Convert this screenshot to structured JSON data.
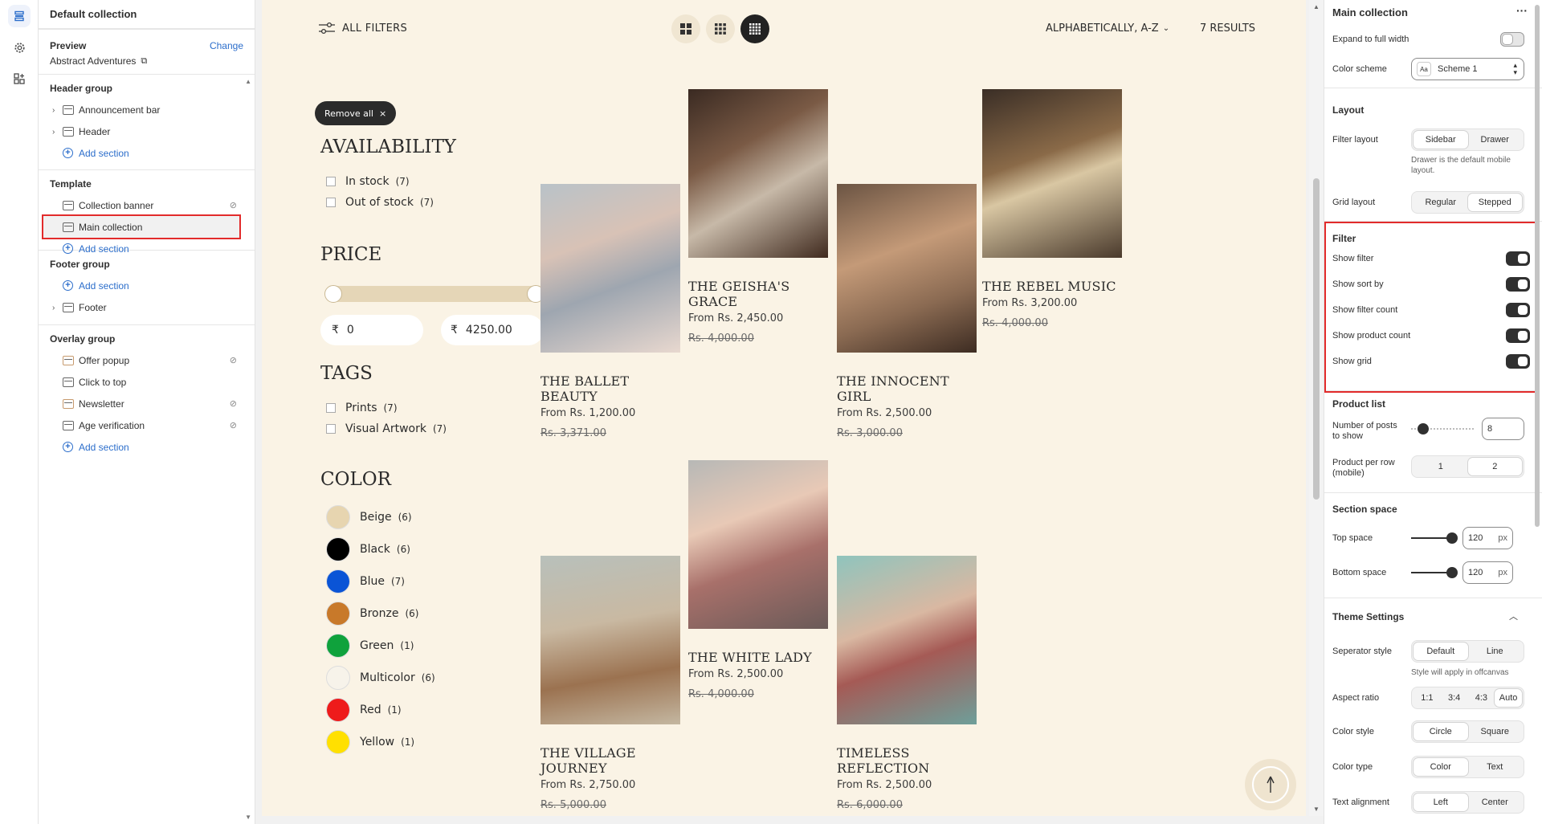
{
  "left_panel": {
    "title": "Default collection",
    "preview_label": "Preview",
    "change_label": "Change",
    "preview_value": "Abstract Adventures",
    "header_group": {
      "title": "Header group",
      "items": [
        "Announcement bar",
        "Header"
      ],
      "add": "Add section"
    },
    "template": {
      "title": "Template",
      "items": [
        "Collection banner",
        "Main collection"
      ],
      "add": "Add section"
    },
    "footer_group": {
      "title": "Footer group",
      "add": "Add section",
      "items": [
        "Footer"
      ]
    },
    "overlay_group": {
      "title": "Overlay group",
      "items": [
        "Offer popup",
        "Click to top",
        "Newsletter",
        "Age verification"
      ],
      "add": "Add section"
    }
  },
  "store": {
    "all_filters": "ALL FILTERS",
    "sort": "ALPHABETICALLY, A-Z",
    "results": "7 RESULTS",
    "remove_all": "Remove all",
    "availability": {
      "title": "AVAILABILITY",
      "options": [
        {
          "label": "In stock",
          "count": "(7)"
        },
        {
          "label": "Out of stock",
          "count": "(7)"
        }
      ]
    },
    "price": {
      "title": "PRICE",
      "currency": "₹",
      "min": "0",
      "max": "4250.00"
    },
    "tags": {
      "title": "TAGS",
      "options": [
        {
          "label": "Prints",
          "count": "(7)"
        },
        {
          "label": "Visual Artwork",
          "count": "(7)"
        }
      ]
    },
    "color": {
      "title": "COLOR",
      "options": [
        {
          "label": "Beige",
          "count": "(6)",
          "hex": "#e7d5b0"
        },
        {
          "label": "Black",
          "count": "(6)",
          "hex": "#000000"
        },
        {
          "label": "Blue",
          "count": "(7)",
          "hex": "#0a54d6"
        },
        {
          "label": "Bronze",
          "count": "(6)",
          "hex": "#c8792a"
        },
        {
          "label": "Green",
          "count": "(1)",
          "hex": "#0fa23c"
        },
        {
          "label": "Multicolor",
          "count": "(6)",
          "hex": "#f7f3ea"
        },
        {
          "label": "Red",
          "count": "(1)",
          "hex": "#ee1b1b"
        },
        {
          "label": "Yellow",
          "count": "(1)",
          "hex": "#ffe000"
        }
      ]
    },
    "products": [
      {
        "name": "THE BALLET BEAUTY",
        "price": "From Rs. 1,200.00",
        "old": "Rs. 3,371.00"
      },
      {
        "name": "THE GEISHA'S GRACE",
        "price": "From Rs. 2,450.00",
        "old": "Rs. 4,000.00"
      },
      {
        "name": "THE INNOCENT GIRL",
        "price": "From Rs. 2,500.00",
        "old": "Rs. 3,000.00"
      },
      {
        "name": "THE REBEL MUSIC",
        "price": "From Rs. 3,200.00",
        "old": "Rs. 4,000.00"
      },
      {
        "name": "THE VILLAGE JOURNEY",
        "price": "From Rs. 2,750.00",
        "old": "Rs. 5,000.00"
      },
      {
        "name": "THE WHITE LADY",
        "price": "From Rs. 2,500.00",
        "old": "Rs. 4,000.00"
      },
      {
        "name": "TIMELESS REFLECTION",
        "price": "From Rs. 2,500.00",
        "old": "Rs. 6,000.00"
      }
    ]
  },
  "right_panel": {
    "title": "Main collection",
    "expand": "Expand to full width",
    "color_scheme_label": "Color scheme",
    "color_scheme": "Scheme 1",
    "layout": {
      "title": "Layout",
      "filter_layout": "Filter layout",
      "opts": [
        "Sidebar",
        "Drawer"
      ],
      "hint": "Drawer is the default mobile layout.",
      "grid_layout": "Grid layout",
      "grid_opts": [
        "Regular",
        "Stepped"
      ]
    },
    "filter": {
      "title": "Filter",
      "items": [
        "Show filter",
        "Show sort by",
        "Show filter count",
        "Show product count",
        "Show grid"
      ]
    },
    "product_list": {
      "title": "Product list",
      "posts_label": "Number of posts to show",
      "posts": "8",
      "per_row_label": "Product per row (mobile)",
      "per_row_opts": [
        "1",
        "2"
      ]
    },
    "section_space": {
      "title": "Section space",
      "top_label": "Top space",
      "top": "120",
      "bottom_label": "Bottom space",
      "bottom": "120",
      "unit": "px"
    },
    "theme": {
      "title": "Theme Settings",
      "sep_label": "Seperator style",
      "sep_opts": [
        "Default",
        "Line"
      ],
      "sep_hint": "Style will apply in offcanvas",
      "aspect_label": "Aspect ratio",
      "aspect_opts": [
        "1:1",
        "3:4",
        "4:3",
        "Auto"
      ],
      "cstyle_label": "Color style",
      "cstyle_opts": [
        "Circle",
        "Square"
      ],
      "ctype_label": "Color type",
      "ctype_opts": [
        "Color",
        "Text"
      ],
      "talign_label": "Text alignment",
      "talign_opts": [
        "Left",
        "Center"
      ]
    }
  }
}
